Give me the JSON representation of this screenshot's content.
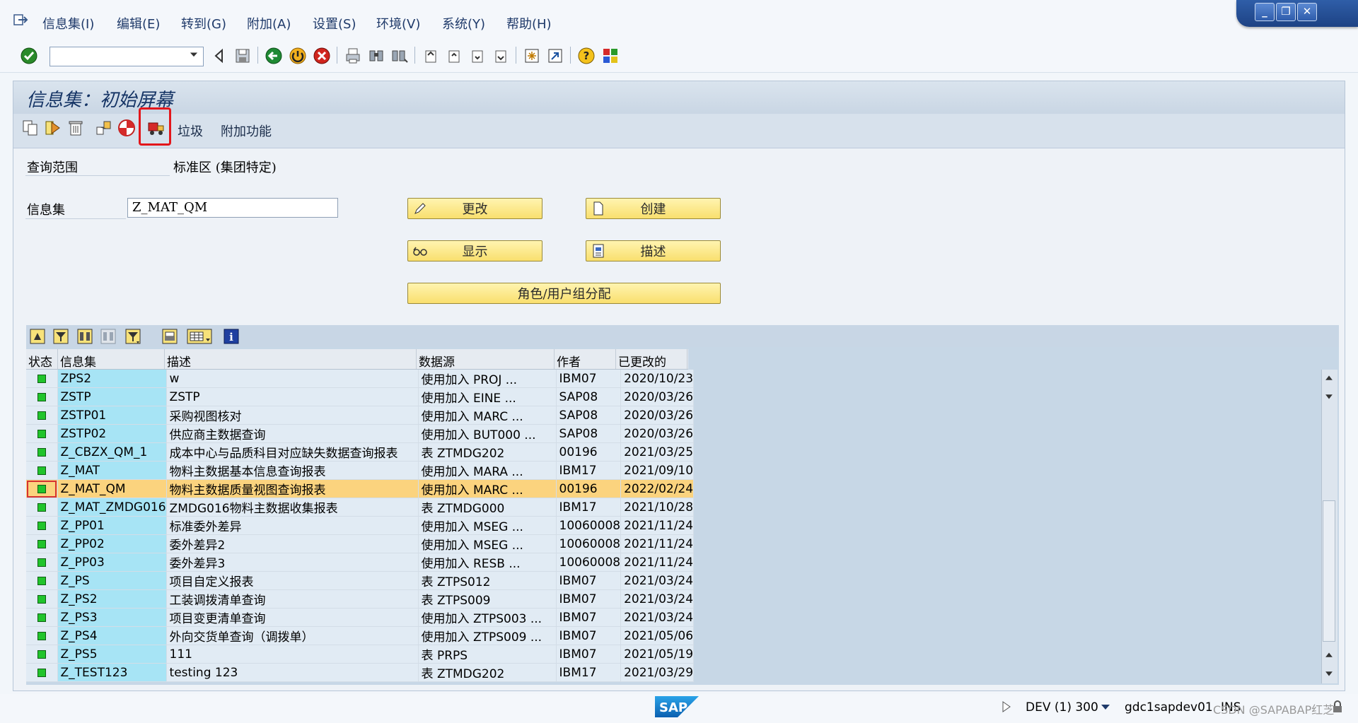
{
  "menu": {
    "items": [
      "信息集(I)",
      "编辑(E)",
      "转到(G)",
      "附加(A)",
      "设置(S)",
      "环境(V)",
      "系统(Y)",
      "帮助(H)"
    ]
  },
  "window_controls": {
    "minimize": "_",
    "restore": "❐",
    "close": "✕"
  },
  "command_field": {
    "value": ""
  },
  "page_title": "信息集：初始屏幕",
  "app_toolbar": {
    "trash_label": "垃圾",
    "extras_label": "附加功能"
  },
  "form": {
    "query_area_label": "查询范围",
    "query_area_value": "标准区 (集团特定)",
    "infoset_label": "信息集",
    "infoset_value": "Z_MAT_QM"
  },
  "buttons": {
    "change": "更改",
    "create": "创建",
    "display": "显示",
    "describe": "描述",
    "role_assign": "角色/用户组分配"
  },
  "grid": {
    "columns": [
      "状态",
      "信息集",
      "描述",
      "数据源",
      "作者",
      "已更改的"
    ],
    "selected_index": 6,
    "rows": [
      {
        "infoset": "ZPS2",
        "desc": "w",
        "source": "使用加入 PROJ ...",
        "author": "IBM07",
        "changed": "2020/10/23"
      },
      {
        "infoset": "ZSTP",
        "desc": "ZSTP",
        "source": "使用加入 EINE ...",
        "author": "SAP08",
        "changed": "2020/03/26"
      },
      {
        "infoset": "ZSTP01",
        "desc": "采购视图核对",
        "source": "使用加入 MARC ...",
        "author": "SAP08",
        "changed": "2020/03/26"
      },
      {
        "infoset": "ZSTP02",
        "desc": "供应商主数据查询",
        "source": "使用加入 BUT000 ...",
        "author": "SAP08",
        "changed": "2020/03/26"
      },
      {
        "infoset": "Z_CBZX_QM_1",
        "desc": "成本中心与品质科目对应缺失数据查询报表",
        "source": "表 ZTMDG202",
        "author": "00196",
        "changed": "2021/03/25"
      },
      {
        "infoset": "Z_MAT",
        "desc": "物料主数据基本信息查询报表",
        "source": "使用加入 MARA ...",
        "author": "IBM17",
        "changed": "2021/09/10"
      },
      {
        "infoset": "Z_MAT_QM",
        "desc": "物料主数据质量视图查询报表",
        "source": "使用加入 MARC ...",
        "author": "00196",
        "changed": "2022/02/24"
      },
      {
        "infoset": "Z_MAT_ZMDG016",
        "desc": "ZMDG016物料主数据收集报表",
        "source": "表 ZTMDG000",
        "author": "IBM17",
        "changed": "2021/10/28"
      },
      {
        "infoset": "Z_PP01",
        "desc": "标准委外差异",
        "source": "使用加入 MSEG ...",
        "author": "10060008",
        "changed": "2021/11/24"
      },
      {
        "infoset": "Z_PP02",
        "desc": "委外差异2",
        "source": "使用加入 MSEG ...",
        "author": "10060008",
        "changed": "2021/11/24"
      },
      {
        "infoset": "Z_PP03",
        "desc": "委外差异3",
        "source": "使用加入 RESB ...",
        "author": "10060008",
        "changed": "2021/11/24"
      },
      {
        "infoset": "Z_PS",
        "desc": "项目自定义报表",
        "source": "表 ZTPS012",
        "author": "IBM07",
        "changed": "2021/03/24"
      },
      {
        "infoset": "Z_PS2",
        "desc": "工装调拨清单查询",
        "source": "表 ZTPS009",
        "author": "IBM07",
        "changed": "2021/03/24"
      },
      {
        "infoset": "Z_PS3",
        "desc": "项目变更清单查询",
        "source": "使用加入 ZTPS003 ...",
        "author": "IBM07",
        "changed": "2021/03/24"
      },
      {
        "infoset": "Z_PS4",
        "desc": "外向交货单查询（调拨单）",
        "source": "使用加入 ZTPS009 ...",
        "author": "IBM07",
        "changed": "2021/05/06"
      },
      {
        "infoset": "Z_PS5",
        "desc": "111",
        "source": "表 PRPS",
        "author": "IBM07",
        "changed": "2021/05/19"
      },
      {
        "infoset": "Z_TEST123",
        "desc": "testing 123",
        "source": "表 ZTMDG202",
        "author": "IBM17",
        "changed": "2021/03/29"
      }
    ]
  },
  "statusbar": {
    "logo": "SAP",
    "system": "DEV (1) 300",
    "server": "gdc1sapdev01",
    "mode": "INS",
    "watermark": "CSDN @SAPABAP红芝"
  },
  "colors": {
    "accent_button": "#f9df6e",
    "selected_row": "#fbd37e",
    "key_column": "#a7e4f5",
    "status_led": "#21c42b",
    "highlight": "#e3161b"
  }
}
